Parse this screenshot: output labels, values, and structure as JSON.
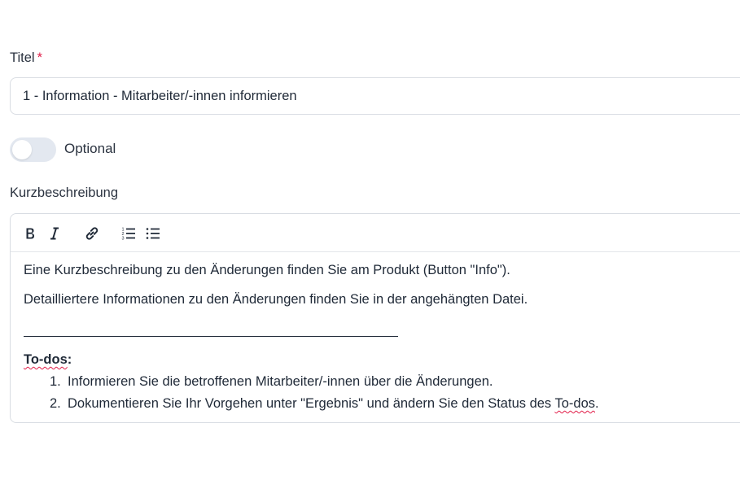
{
  "form": {
    "title_label": "Titel",
    "title_required_marker": "*",
    "title_value": "1 - Information - Mitarbeiter/-innen informieren",
    "optional_label": "Optional",
    "optional_toggle_on": false,
    "description_label": "Kurzbeschreibung"
  },
  "editor": {
    "toolbar": [
      {
        "name": "bold",
        "icon": "bold-icon"
      },
      {
        "name": "italic",
        "icon": "italic-icon"
      },
      {
        "name": "link",
        "icon": "link-icon"
      },
      {
        "name": "ordered-list",
        "icon": "ordered-list-icon"
      },
      {
        "name": "bullet-list",
        "icon": "bullet-list-icon"
      }
    ],
    "paragraph_1": "Eine Kurzbeschreibung zu den Änderungen finden Sie am Produkt (Button \"Info\").",
    "paragraph_2": "Detailliertere Informationen zu den Änderungen finden Sie in der angehängten Datei.",
    "todo_heading": "To-dos",
    "todo_heading_suffix": ":",
    "todos": [
      {
        "number": "1.",
        "text": "Informieren Sie die betroffenen Mitarbeiter/-innen über die Änderungen."
      },
      {
        "number": "2.",
        "text_before": "Dokumentieren Sie Ihr Vorgehen unter \"Ergebnis\" und ändern Sie den Status des ",
        "text_marked": "To-dos",
        "text_after": "."
      }
    ]
  },
  "colors": {
    "required": "#e11d48",
    "border": "#d9dde3",
    "toggle_off": "#e3e8f0",
    "spellcheck": "#e11d48"
  }
}
